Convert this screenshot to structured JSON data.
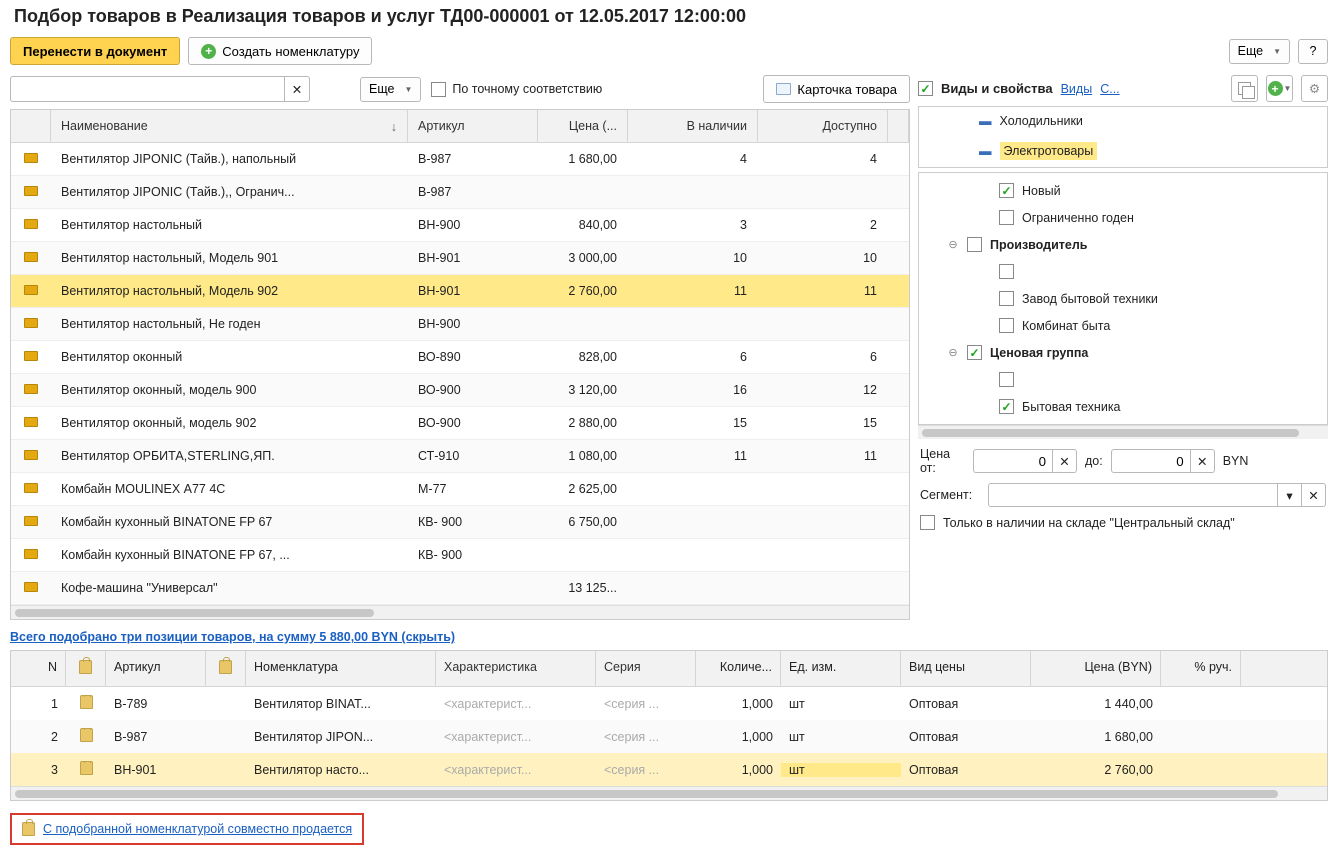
{
  "title": "Подбор товаров в Реализация товаров и услуг ТД00-000001 от 12.05.2017 12:00:00",
  "toolbar": {
    "transfer": "Перенести в документ",
    "create": "Создать номенклатуру",
    "more": "Еще",
    "help": "?"
  },
  "search": {
    "more": "Еще",
    "exact_label": "По точному соответствию",
    "card": "Карточка товара"
  },
  "grid": {
    "headers": {
      "name": "Наименование",
      "art": "Артикул",
      "price": "Цена (...",
      "stock": "В наличии",
      "avail": "Доступно"
    },
    "rows": [
      {
        "name": "Вентилятор JIPONIC (Тайв.), напольный",
        "art": "B-987",
        "price": "1 680,00",
        "stock": "4",
        "avail": "4"
      },
      {
        "name": "Вентилятор JIPONIC (Тайв.),, Огранич...",
        "art": "B-987",
        "price": "",
        "stock": "",
        "avail": ""
      },
      {
        "name": "Вентилятор настольный",
        "art": "ВН-900",
        "price": "840,00",
        "stock": "3",
        "avail": "2"
      },
      {
        "name": "Вентилятор настольный, Модель 901",
        "art": "ВН-901",
        "price": "3 000,00",
        "stock": "10",
        "avail": "10"
      },
      {
        "name": "Вентилятор настольный, Модель 902",
        "art": "ВН-901",
        "price": "2 760,00",
        "stock": "11",
        "avail": "11",
        "selected": true
      },
      {
        "name": "Вентилятор настольный, Не годен",
        "art": "ВН-900",
        "price": "",
        "stock": "",
        "avail": ""
      },
      {
        "name": "Вентилятор оконный",
        "art": "ВО-890",
        "price": "828,00",
        "stock": "6",
        "avail": "6"
      },
      {
        "name": "Вентилятор оконный, модель 900",
        "art": "ВО-900",
        "price": "3 120,00",
        "stock": "16",
        "avail": "12"
      },
      {
        "name": "Вентилятор оконный, модель 902",
        "art": "ВО-900",
        "price": "2 880,00",
        "stock": "15",
        "avail": "15"
      },
      {
        "name": "Вентилятор ОРБИТА,STERLING,ЯП.",
        "art": "СТ-910",
        "price": "1 080,00",
        "stock": "11",
        "avail": "11"
      },
      {
        "name": "Комбайн MOULINEX  А77 4С",
        "art": "М-77",
        "price": "2 625,00",
        "stock": "",
        "avail": ""
      },
      {
        "name": "Комбайн кухонный BINATONE FP 67",
        "art": "КВ- 900",
        "price": "6 750,00",
        "stock": "",
        "avail": ""
      },
      {
        "name": "Комбайн кухонный BINATONE FP 67, ...",
        "art": "КВ- 900",
        "price": "",
        "stock": "",
        "avail": ""
      },
      {
        "name": "Кофе-машина \"Универсал\"",
        "art": "",
        "price": "13 125...",
        "stock": "",
        "avail": ""
      }
    ]
  },
  "right": {
    "header": "Виды и свойства",
    "link_types": "Виды",
    "link_props": "С...",
    "tree": [
      {
        "label": "Холодильники"
      },
      {
        "label": "Электротовары",
        "selected": true
      }
    ],
    "filters": [
      {
        "level": 1,
        "checked": true,
        "label": "Новый"
      },
      {
        "level": 1,
        "checked": false,
        "label": "Ограниченно годен"
      },
      {
        "level": 0,
        "toggle": "⊖",
        "checked": false,
        "label": "Производитель",
        "bold": true
      },
      {
        "level": 1,
        "checked": false,
        "label": ""
      },
      {
        "level": 1,
        "checked": false,
        "label": "Завод бытовой техники"
      },
      {
        "level": 1,
        "checked": false,
        "label": "Комбинат быта"
      },
      {
        "level": 0,
        "toggle": "⊖",
        "checked": true,
        "label": "Ценовая группа",
        "bold": true
      },
      {
        "level": 1,
        "checked": false,
        "label": ""
      },
      {
        "level": 1,
        "checked": true,
        "label": "Бытовая техника"
      }
    ],
    "price": {
      "label_from": "Цена от:",
      "from": "0",
      "label_to": "до:",
      "to": "0",
      "ccy": "BYN"
    },
    "segment_label": "Сегмент:",
    "only_stock": "Только в наличии на складе \"Центральный склад\""
  },
  "summary": "Всего подобрано три позиции товаров, на сумму 5 880,00 BYN (скрыть)",
  "btable": {
    "headers": {
      "n": "N",
      "art": "Артикул",
      "nom": "Номенклатура",
      "char": "Характеристика",
      "ser": "Серия",
      "qty": "Количе...",
      "uom": "Ед. изм.",
      "ptype": "Вид цены",
      "price": "Цена (BYN)",
      "pct": "% руч."
    },
    "rows": [
      {
        "n": "1",
        "art": "B-789",
        "nom": "Вентилятор BINAT...",
        "char": "<характерист...",
        "ser": "<серия ...",
        "qty": "1,000",
        "uom": "шт",
        "ptype": "Оптовая",
        "price": "1 440,00"
      },
      {
        "n": "2",
        "art": "B-987",
        "nom": "Вентилятор JIPON...",
        "char": "<характерист...",
        "ser": "<серия ...",
        "qty": "1,000",
        "uom": "шт",
        "ptype": "Оптовая",
        "price": "1 680,00"
      },
      {
        "n": "3",
        "art": "ВН-901",
        "nom": "Вентилятор насто...",
        "char": "<характерист...",
        "ser": "<серия ...",
        "qty": "1,000",
        "uom": "шт",
        "ptype": "Оптовая",
        "price": "2 760,00",
        "selected": true
      }
    ]
  },
  "cross_sell": "С подобранной номенклатурой совместно продается"
}
